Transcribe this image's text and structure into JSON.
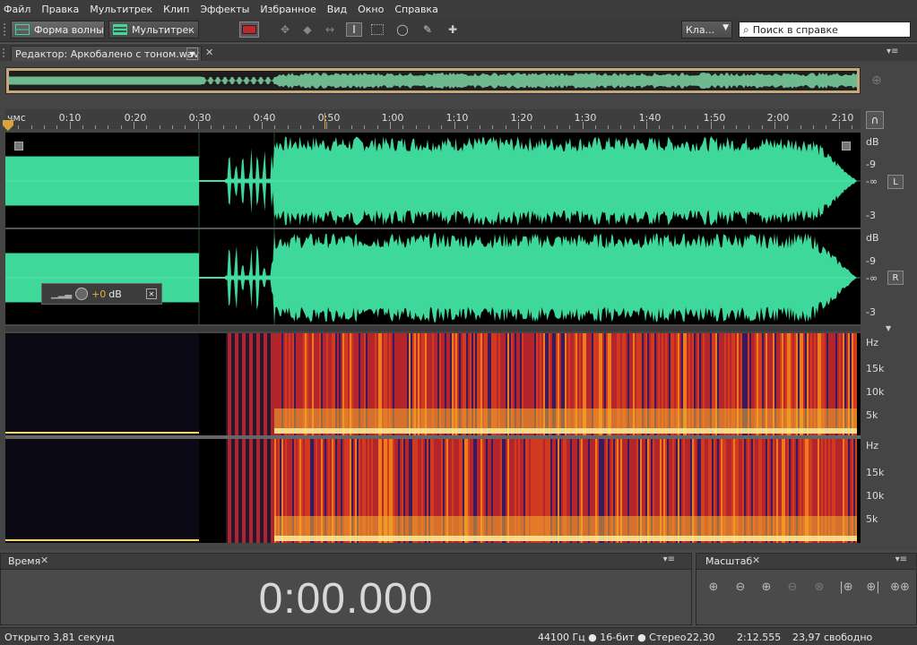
{
  "menu": [
    "Файл",
    "Правка",
    "Мультитрек",
    "Клип",
    "Эффекты",
    "Избранное",
    "Вид",
    "Окно",
    "Справка"
  ],
  "toolbar": {
    "waveform_label": "Форма волны",
    "multitrack_label": "Мультитрек",
    "workspace_value": "Кла...",
    "help_search_placeholder": "Поиск в справке"
  },
  "editor": {
    "tab_label": "Редактор: Аркобалено с тоном.wav"
  },
  "ruler": {
    "unit": "чмс",
    "ticks": [
      "0:10",
      "0:20",
      "0:30",
      "0:40",
      "0:50",
      "1:00",
      "1:10",
      "1:20",
      "1:30",
      "1:40",
      "1:50",
      "2:00",
      "2:10"
    ]
  },
  "waveform": {
    "db_labels_top": [
      "dB",
      "-9",
      "-∞",
      "-3"
    ],
    "db_labels_bottom": [
      "dB",
      "-9",
      "-∞",
      "-3"
    ],
    "channel_top": "L",
    "channel_bottom": "R",
    "gain_value": "+0",
    "gain_unit": "dB",
    "wave_color": "#3ed99a"
  },
  "spectrum": {
    "hz_labels_top": [
      "Hz",
      "15k",
      "10k",
      "5k"
    ],
    "hz_labels_bottom": [
      "Hz",
      "15k",
      "10k",
      "5k"
    ]
  },
  "time_panel": {
    "tab_label": "Время",
    "value": "0:00.000"
  },
  "zoom_panel": {
    "tab_label": "Масштаб"
  },
  "status": {
    "opened": "Открыто 3,81 секунд",
    "format": "44100 Гц ● 16-бит ● Стерео",
    "size_mb": "22,30",
    "duration": "2:12.555",
    "free_space": "23,97 свободно"
  }
}
